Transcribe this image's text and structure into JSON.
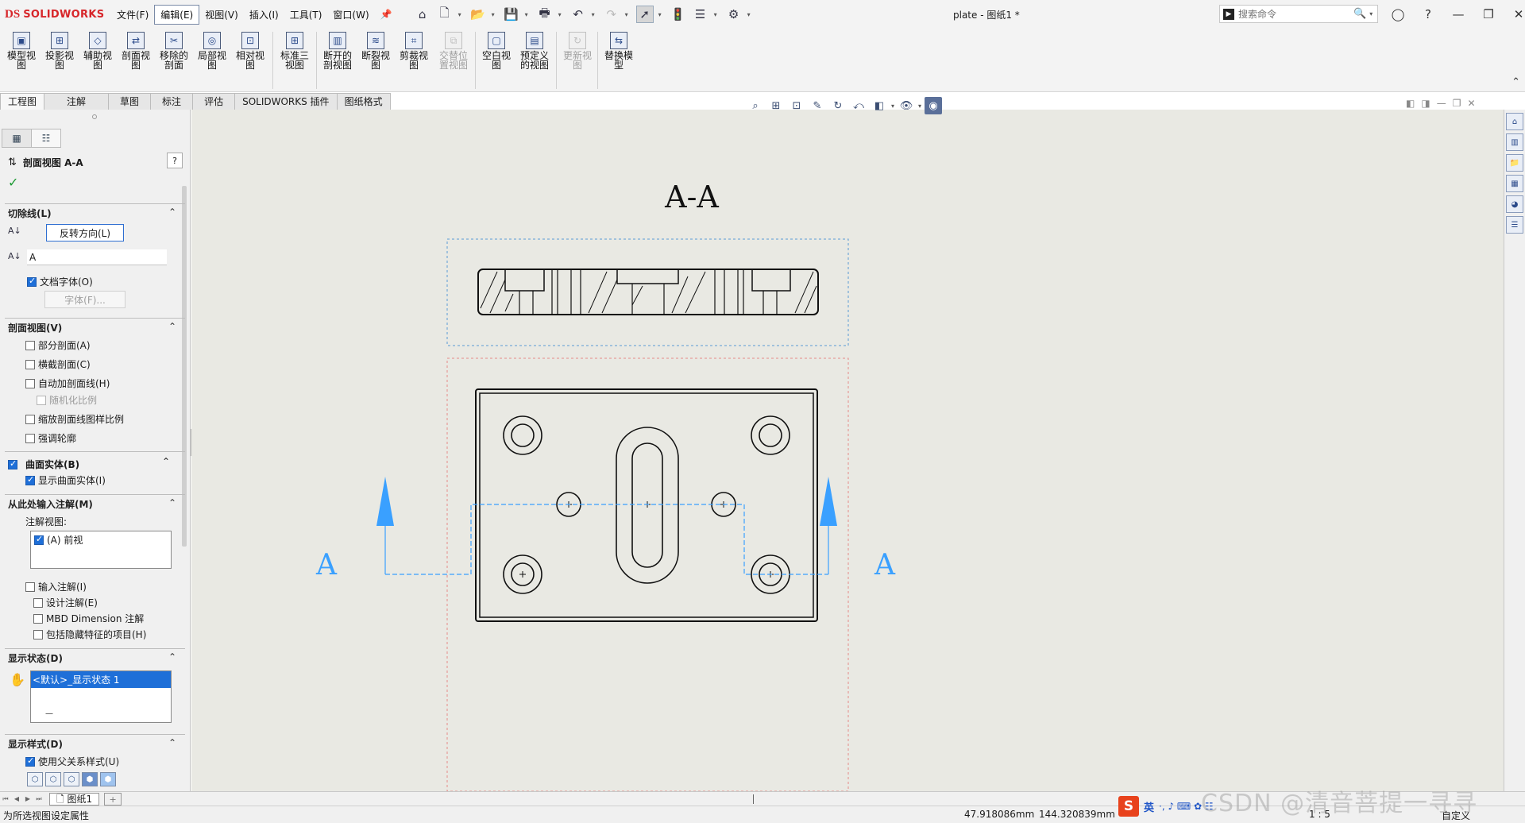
{
  "app": {
    "logo_mark": "DS",
    "logo_text": "SOLIDWORKS",
    "doc_title": "plate - 图纸1 *"
  },
  "menu": [
    "文件(F)",
    "编辑(E)",
    "视图(V)",
    "插入(I)",
    "工具(T)",
    "窗口(W)"
  ],
  "menu_active_index": 1,
  "search": {
    "placeholder": "搜索命令"
  },
  "commands": [
    {
      "label": "模型视图",
      "glyph": "▣"
    },
    {
      "label": "投影视图",
      "glyph": "⊞"
    },
    {
      "label": "辅助视图",
      "glyph": "◇"
    },
    {
      "label": "剖面视图",
      "glyph": "⇄"
    },
    {
      "label": "移除的剖面",
      "glyph": "✂"
    },
    {
      "label": "局部视图",
      "glyph": "◎"
    },
    {
      "label": "相对视图",
      "glyph": "⊡"
    },
    {
      "label": "标准三视图",
      "glyph": "⊞"
    },
    {
      "label": "断开的剖视图",
      "glyph": "▥"
    },
    {
      "label": "断裂视图",
      "glyph": "≋"
    },
    {
      "label": "剪裁视图",
      "glyph": "⌗"
    },
    {
      "label": "交替位置视图",
      "glyph": "⧉",
      "disabled": true
    },
    {
      "label": "空白视图",
      "glyph": "▢"
    },
    {
      "label": "预定义的视图",
      "glyph": "▤"
    },
    {
      "label": "更新视图",
      "glyph": "↻",
      "disabled": true
    },
    {
      "label": "替换模型",
      "glyph": "⇆"
    }
  ],
  "tabs": [
    "工程图",
    "注解",
    "草图",
    "标注",
    "评估",
    "SOLIDWORKS 插件",
    "图纸格式"
  ],
  "pm": {
    "title": "剖面视图 A-A",
    "help": "?",
    "ok": "✓",
    "cutline": {
      "header": "切除线(L)",
      "reverse_btn": "反转方向(L)",
      "label_value": "A",
      "doc_font": "文档字体(O)",
      "font_btn": "字体(F)..."
    },
    "section_view": {
      "header": "剖面视图(V)",
      "partial": "部分剖面(A)",
      "slice": "横截剖面(C)",
      "auto_hatch": "自动加剖面线(H)",
      "randomize": "随机化比例",
      "scale_hatch": "缩放剖面线图样比例",
      "emphasize": "强调轮廓"
    },
    "surface": {
      "header": "曲面实体(B)",
      "show": "显示曲面实体(I)"
    },
    "import_ann": {
      "header": "从此处输入注解(M)",
      "views_label": "注解视图:",
      "view_item": "(A) 前视",
      "import": "输入注解(I)",
      "design": "设计注解(E)",
      "mbd": "MBD Dimension 注解",
      "hidden": "包括隐藏特征的项目(H)"
    },
    "display_state": {
      "header": "显示状态(D)",
      "item": "<默认>_显示状态 1",
      "dash": "—"
    },
    "display_style": {
      "header": "显示样式(D)",
      "use_parent": "使用父关系样式(U)"
    }
  },
  "drawing": {
    "view_label": "A-A",
    "cut_label_left": "A",
    "cut_label_right": "A",
    "colors": {
      "line": "#111111",
      "arrow": "#3aa0ff",
      "frame_top": "#5b9bd5",
      "frame_bottom": "#e58a8a"
    }
  },
  "sheet_tab": "图纸1",
  "status": {
    "message": "为所选视图设定属性",
    "x": "47.918086mm",
    "y": "144.320839mm",
    "scale": "1 : 5",
    "custom": "自定义"
  },
  "ime": {
    "s": "S",
    "lang": "英",
    "rest": "·, ♪ ⌨ ✿ ☷"
  },
  "watermark": "CSDN @清音菩提一寻寻"
}
